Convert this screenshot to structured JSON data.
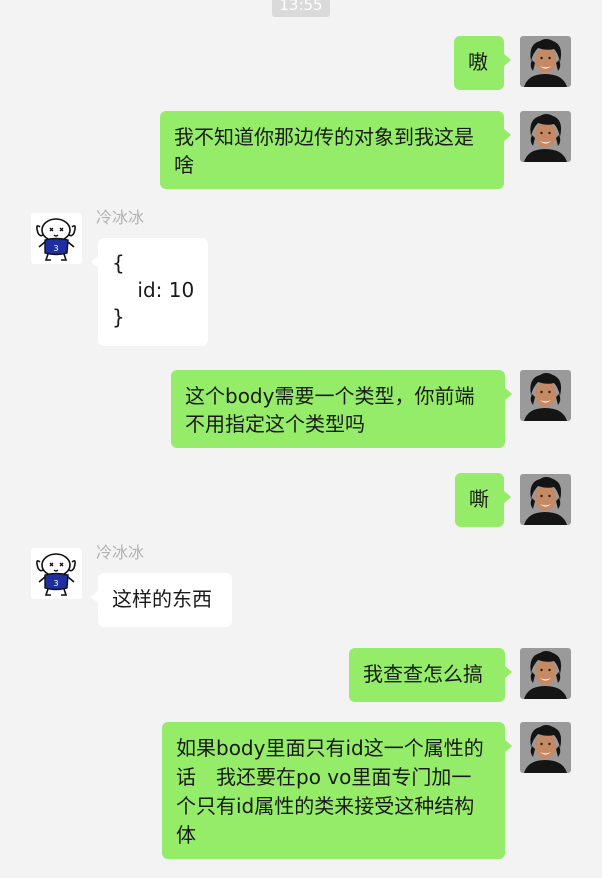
{
  "time": "13:55",
  "contact_name": "冷冰冰",
  "messages": [
    {
      "from": "me",
      "text": "嗷"
    },
    {
      "from": "me",
      "text": "我不知道你那边传的对象到我这是啥"
    },
    {
      "from": "other",
      "sender": "冷冰冰",
      "lines": [
        "{",
        "    id: 10",
        "}"
      ]
    },
    {
      "from": "me",
      "text": "这个body需要一个类型，你前端不用指定这个类型吗"
    },
    {
      "from": "me",
      "text": "嘶"
    },
    {
      "from": "other",
      "sender": "冷冰冰",
      "text": "这样的东西"
    },
    {
      "from": "me",
      "text": "我查查怎么搞"
    },
    {
      "from": "me",
      "text": "如果body里面只有id这一个属性的话　我还要在po vo里面专门加一个只有id属性的类来接受这种结构体"
    }
  ],
  "avatars": {
    "me": "man-portrait-avatar",
    "other": "dog-cartoon-avatar"
  },
  "colors": {
    "my_bubble": "#95ec69",
    "other_bubble": "#ffffff",
    "background": "#f3f3f3"
  }
}
